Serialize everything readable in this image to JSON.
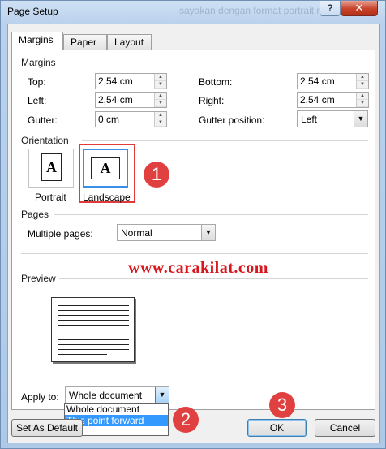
{
  "window": {
    "title": "Page Setup",
    "bg_text": "sayakan dengan format portrait maka secara",
    "help_label": "?",
    "close_label": "✕"
  },
  "tabs": [
    "Margins",
    "Paper",
    "Layout"
  ],
  "margins": {
    "section": "Margins",
    "top_label": "Top:",
    "top_value": "2,54 cm",
    "bottom_label": "Bottom:",
    "bottom_value": "2,54 cm",
    "left_label": "Left:",
    "left_value": "2,54 cm",
    "right_label": "Right:",
    "right_value": "2,54 cm",
    "gutter_label": "Gutter:",
    "gutter_value": "0 cm",
    "gutter_pos_label": "Gutter position:",
    "gutter_pos_value": "Left"
  },
  "orientation": {
    "section": "Orientation",
    "portrait_label": "Portrait",
    "landscape_label": "Landscape",
    "glyph": "A",
    "selected": "Landscape"
  },
  "pages": {
    "section": "Pages",
    "multiple_label": "Multiple pages:",
    "multiple_value": "Normal"
  },
  "watermark": "www.carakilat.com",
  "preview": {
    "section": "Preview"
  },
  "apply": {
    "label": "Apply to:",
    "value": "Whole document",
    "options": [
      "Whole document",
      "This point forward"
    ],
    "highlighted": "This point forward"
  },
  "buttons": {
    "set_default": "Set As Default",
    "ok": "OK",
    "cancel": "Cancel"
  },
  "badges": [
    "1",
    "2",
    "3"
  ],
  "colors": {
    "annotation_red": "#e03a3a",
    "selection_blue": "#3399ff",
    "watermark_red": "#d8161b"
  }
}
